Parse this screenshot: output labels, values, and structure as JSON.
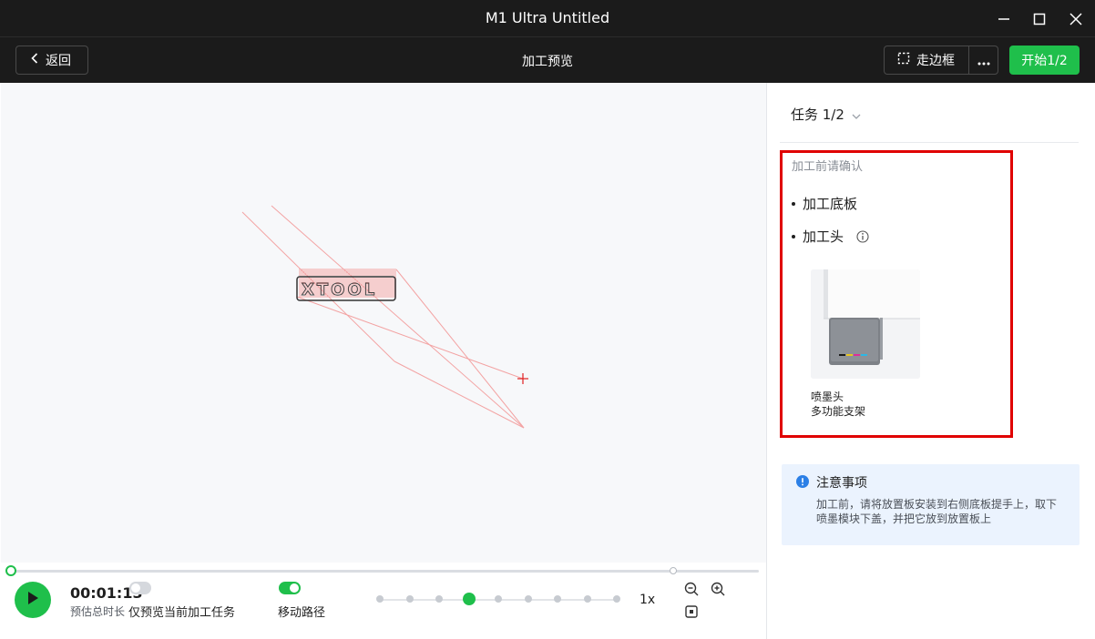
{
  "window": {
    "title": "M1 Ultra Untitled",
    "controls": [
      "minimize-icon",
      "maximize-icon",
      "close-icon"
    ]
  },
  "toolbar": {
    "back_label": "返回",
    "page_title": "加工预览",
    "frame_label": "走边框",
    "more_icon": "more-horizontal-icon",
    "start_label": "开始1/2",
    "accent_color": "#1fbf4b"
  },
  "canvas": {
    "logo_text": "XTOOL",
    "path_color": "#f3a3a3",
    "origin_marker_color": "#e02020"
  },
  "playback": {
    "time": "00:01:13",
    "time_label": "预估总时长",
    "progress": 0,
    "preview_current_only_label": "仅预览当前加工任务",
    "preview_current_only_enabled": false,
    "move_path_label": "移动路径",
    "move_path_enabled": true,
    "speed_steps": 9,
    "speed_selected_index": 3,
    "speed_label": "1x",
    "zoom_controls": [
      "zoom-out-icon",
      "zoom-in-icon",
      "fit-view-icon"
    ]
  },
  "sidebar": {
    "task_label": "任务 1/2",
    "confirm_title": "加工前请确认",
    "confirm_items": [
      {
        "label": "加工底板"
      },
      {
        "label": "加工头",
        "icon": "info-icon"
      }
    ],
    "module_name": "喷墨头",
    "module_subtitle": "多功能支架",
    "notice": {
      "title": "注意事项",
      "body": "加工前，请将放置板安装到右侧底板提手上，取下喷墨模块下盖，并把它放到放置板上",
      "accent_color": "#2b7fe6"
    }
  }
}
